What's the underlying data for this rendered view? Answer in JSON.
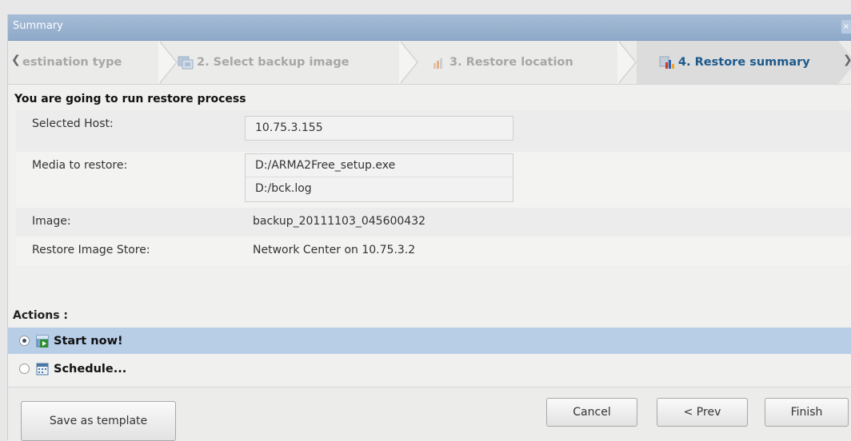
{
  "dialog": {
    "title": "Summary",
    "close_label": "×"
  },
  "wizard": {
    "steps": [
      {
        "label": "estination type",
        "active": false
      },
      {
        "label": "2. Select backup image",
        "active": false
      },
      {
        "label": "3. Restore location",
        "active": false
      },
      {
        "label": "4. Restore summary",
        "active": true
      }
    ]
  },
  "summary": {
    "heading": "You are going to run restore process",
    "selected_host_label": "Selected Host:",
    "selected_host_value": "10.75.3.155",
    "media_label": "Media to restore:",
    "media_items": [
      "D:/ARMA2Free_setup.exe",
      "D:/bck.log"
    ],
    "image_label": "Image:",
    "image_value": "backup_20111103_045600432",
    "store_label": "Restore Image Store:",
    "store_value": "Network Center on 10.75.3.2"
  },
  "actions": {
    "heading": "Actions :",
    "options": [
      {
        "label": "Start now!",
        "selected": true
      },
      {
        "label": "Schedule...",
        "selected": false
      }
    ]
  },
  "buttons": {
    "save_template": "Save as template",
    "cancel": "Cancel",
    "prev": "< Prev",
    "finish": "Finish"
  }
}
